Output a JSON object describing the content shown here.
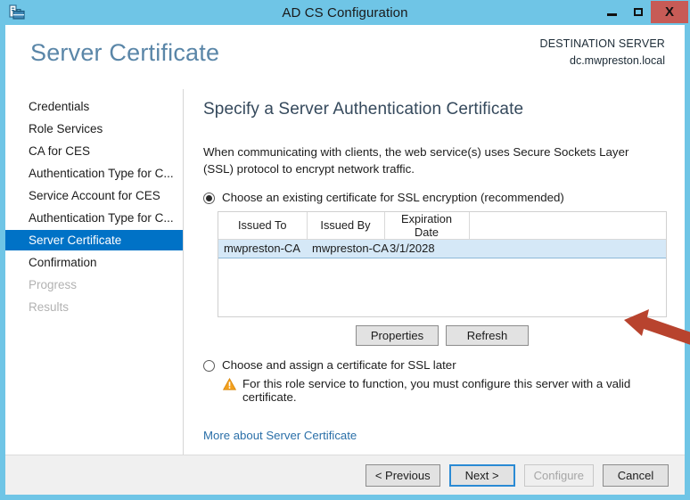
{
  "window": {
    "title": "AD CS Configuration",
    "icon": "certificate-server-icon",
    "minimize_label": "Minimize",
    "maximize_label": "Maximize",
    "close_label": "X",
    "titlebar_color": "#6fc5e6",
    "close_color": "#c75b56"
  },
  "header": {
    "page_title": "Server Certificate",
    "destination_label": "DESTINATION SERVER",
    "destination_value": "dc.mwpreston.local"
  },
  "sidebar": {
    "items": [
      {
        "label": "Credentials",
        "state": "normal"
      },
      {
        "label": "Role Services",
        "state": "normal"
      },
      {
        "label": "CA for CES",
        "state": "normal"
      },
      {
        "label": "Authentication Type for C...",
        "state": "normal"
      },
      {
        "label": "Service Account for CES",
        "state": "normal"
      },
      {
        "label": "Authentication Type for C...",
        "state": "normal"
      },
      {
        "label": "Server Certificate",
        "state": "active"
      },
      {
        "label": "Confirmation",
        "state": "normal"
      },
      {
        "label": "Progress",
        "state": "disabled"
      },
      {
        "label": "Results",
        "state": "disabled"
      }
    ],
    "active_color": "#0072c6"
  },
  "main": {
    "heading": "Specify a Server Authentication Certificate",
    "intro": "When communicating with clients, the web service(s) uses Secure Sockets Layer (SSL) protocol to encrypt network traffic.",
    "option_existing": {
      "label": "Choose an existing certificate for SSL encryption (recommended)",
      "selected": true
    },
    "option_later": {
      "label": "Choose and assign a certificate for SSL later",
      "selected": false
    },
    "warning": {
      "icon": "warning-triangle-icon",
      "text": "For this role service to function, you must configure this server with a valid certificate.",
      "color": "#f3a01c"
    },
    "more_link": "More about Server Certificate"
  },
  "cert_table": {
    "columns": [
      "Issued To",
      "Issued By",
      "Expiration Date"
    ],
    "rows": [
      {
        "issued_to": "mwpreston-CA",
        "issued_by": "mwpreston-CA",
        "expiration_date": "3/1/2028",
        "selected": true
      }
    ],
    "selected_row_color": "#d5e8f7"
  },
  "table_actions": {
    "properties_label": "Properties",
    "refresh_label": "Refresh"
  },
  "footer": {
    "previous_label": "< Previous",
    "next_label": "Next >",
    "configure_label": "Configure",
    "cancel_label": "Cancel",
    "next_is_default": true,
    "configure_disabled": true
  },
  "annotation": {
    "type": "arrow",
    "direction": "left",
    "color": "#b8432e",
    "points_at": "expiration-date-cell"
  }
}
